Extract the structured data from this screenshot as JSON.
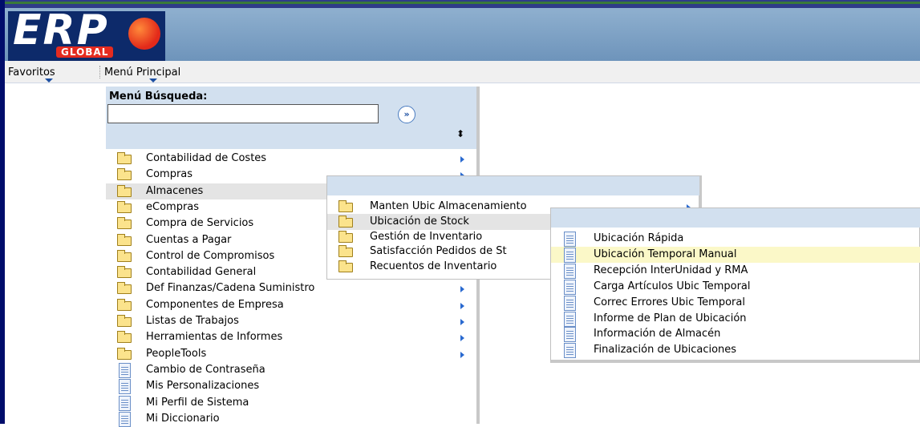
{
  "brand": {
    "logo_text": "ERP",
    "logo_sub": "GLOBAL",
    "colors": {
      "frame": "#000d6b",
      "header": "#7a9fc4",
      "logo_red": "#e52b1f",
      "search_panel": "#d2e0ef",
      "highlight": "#fbf8c8"
    }
  },
  "navbar": {
    "favorites": "Favoritos",
    "main_menu": "Menú Principal"
  },
  "search": {
    "label": "Menú Búsqueda:",
    "value": "",
    "go_icon": "double-chevron-right-icon",
    "sort_icon": "sort-updown-icon"
  },
  "menu1": {
    "items": [
      {
        "label": "Contabilidad de Costes",
        "icon": "folder-icon",
        "submenu": true
      },
      {
        "label": "Compras",
        "icon": "folder-icon",
        "submenu": true
      },
      {
        "label": "Almacenes",
        "icon": "folder-icon",
        "submenu": true,
        "selected": true
      },
      {
        "label": "eCompras",
        "icon": "folder-icon",
        "submenu": true
      },
      {
        "label": "Compra de Servicios",
        "icon": "folder-icon",
        "submenu": true
      },
      {
        "label": "Cuentas a Pagar",
        "icon": "folder-icon",
        "submenu": true
      },
      {
        "label": "Control de Compromisos",
        "icon": "folder-icon",
        "submenu": true
      },
      {
        "label": "Contabilidad General",
        "icon": "folder-icon",
        "submenu": true
      },
      {
        "label": "Def Finanzas/Cadena Suministro",
        "icon": "folder-icon",
        "submenu": true
      },
      {
        "label": "Componentes de Empresa",
        "icon": "folder-icon",
        "submenu": true
      },
      {
        "label": "Listas de Trabajos",
        "icon": "folder-icon",
        "submenu": true
      },
      {
        "label": "Herramientas de Informes",
        "icon": "folder-icon",
        "submenu": true
      },
      {
        "label": "PeopleTools",
        "icon": "folder-icon",
        "submenu": true
      },
      {
        "label": "Cambio de Contraseña",
        "icon": "document-icon",
        "submenu": false
      },
      {
        "label": "Mis Personalizaciones",
        "icon": "document-icon",
        "submenu": false
      },
      {
        "label": "Mi Perfil de Sistema",
        "icon": "document-icon",
        "submenu": false
      },
      {
        "label": "Mi Diccionario",
        "icon": "document-icon",
        "submenu": false
      }
    ]
  },
  "menu2": {
    "items": [
      {
        "label": "Manten Ubic Almacenamiento",
        "icon": "folder-icon",
        "submenu": true
      },
      {
        "label": "Ubicación de Stock",
        "icon": "folder-icon",
        "submenu": true,
        "selected": true
      },
      {
        "label": "Gestión de Inventario",
        "icon": "folder-icon",
        "submenu": true
      },
      {
        "label": "Satisfacción Pedidos de St",
        "icon": "folder-icon",
        "submenu": true
      },
      {
        "label": "Recuentos de Inventario",
        "icon": "folder-icon",
        "submenu": true
      }
    ]
  },
  "menu3": {
    "items": [
      {
        "label": "Ubicación Rápida",
        "icon": "document-icon"
      },
      {
        "label": "Ubicación Temporal Manual",
        "icon": "document-icon",
        "hovered": true
      },
      {
        "label": "Recepción InterUnidad y RMA",
        "icon": "document-icon"
      },
      {
        "label": "Carga Artículos Ubic Temporal",
        "icon": "document-icon"
      },
      {
        "label": "Correc Errores Ubic Temporal",
        "icon": "document-icon"
      },
      {
        "label": "Informe de Plan de Ubicación",
        "icon": "document-icon"
      },
      {
        "label": "Información de Almacén",
        "icon": "document-icon"
      },
      {
        "label": "Finalización de Ubicaciones",
        "icon": "document-icon"
      }
    ]
  }
}
